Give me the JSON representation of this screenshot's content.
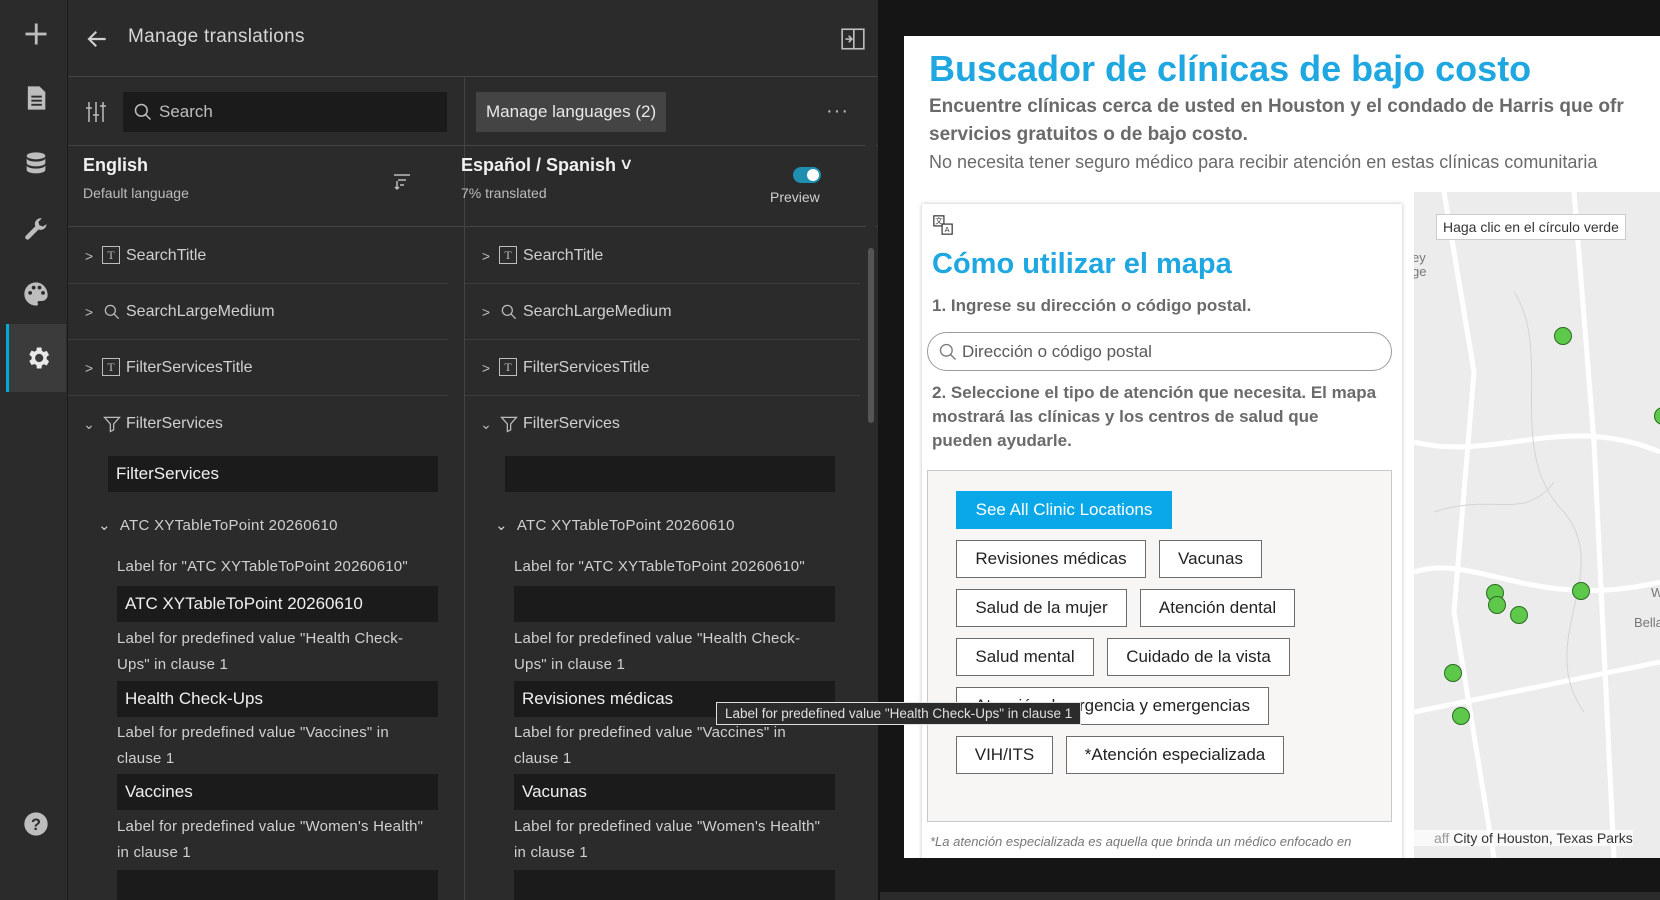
{
  "panel": {
    "title": "Manage translations",
    "search_placeholder": "Search",
    "manage_languages_label": "Manage languages (2)",
    "more_label": "···"
  },
  "source_lang": {
    "name": "English",
    "sub": "Default language"
  },
  "target_lang": {
    "name": "Español / Spanish ˅",
    "sub": "7% translated",
    "preview_label": "Preview",
    "preview_on": true
  },
  "tree": [
    {
      "label": "SearchTitle"
    },
    {
      "label": "SearchLargeMedium"
    },
    {
      "label": "FilterServicesTitle"
    },
    {
      "label": "FilterServices"
    }
  ],
  "filter_services": {
    "source_value": "FilterServices",
    "target_value": "",
    "sublayer": "ATC XYTableToPoint 20260610",
    "label_for_layer": "Label for \"ATC XYTableToPoint 20260610\"",
    "layer_source_value": "ATC XYTableToPoint 20260610",
    "layer_target_value": "",
    "label_health_line1": "Label for predefined value \"Health Check-",
    "label_health_line2": "Ups\" in clause 1",
    "health_source": "Health Check-Ups",
    "health_target": "Revisiones médicas",
    "label_vaccines_line1": "Label for predefined value \"Vaccines\" in",
    "label_vaccines_line2": "clause 1",
    "vaccines_source": "Vaccines",
    "vaccines_target": "Vacunas",
    "label_women_line1": "Label for predefined value \"Women's Health\"",
    "label_women_line2": "in clause 1"
  },
  "tooltip": "Label for predefined value \"Health Check-Ups\" in clause 1",
  "preview": {
    "title": "Buscador de clínicas de bajo costo",
    "subtitle_line1": "Encuentre clínicas cerca de usted en Houston y el condado de Harris que ofr",
    "subtitle_line2": "servicios gratuitos o de bajo costo.",
    "note": "No necesita tener seguro médico para recibir atención en estas clínicas comunitaria",
    "card_title": "Cómo utilizar el mapa",
    "step1": "1. Ingrese su dirección o código postal.",
    "address_placeholder": "Dirección o código postal",
    "step2_line1": "2. Seleccione el tipo de atención que necesita. El mapa",
    "step2_line2": "mostrará las clínicas y los centros de salud que",
    "step2_line3": "pueden ayudarle.",
    "buttons": {
      "all": "See All Clinic Locations",
      "checkups": "Revisiones médicas",
      "vaccines": "Vacunas",
      "women": "Salud de la mujer",
      "dental": "Atención dental",
      "mental": "Salud mental",
      "vision": "Cuidado de la vista",
      "urgent": "Atención de urgencia y emergencias",
      "hiv": "VIH/ITS",
      "specialized": "*Atención especializada"
    },
    "footnote": "*La atención especializada es aquella que brinda un médico enfocado en",
    "map_tip": "Haga clic en el círculo verde",
    "map_attribution": "City of Houston, Texas Parks",
    "map_place_1": "ey",
    "map_place_2": "ge",
    "map_place_3": "We",
    "map_place_4": "Bellair",
    "map_place_5": "aff"
  },
  "colors": {
    "accent": "#1fa7e1",
    "button_primary": "#0aa8e8",
    "toggle": "#1f8fb0",
    "marker": "#5ec84a"
  }
}
